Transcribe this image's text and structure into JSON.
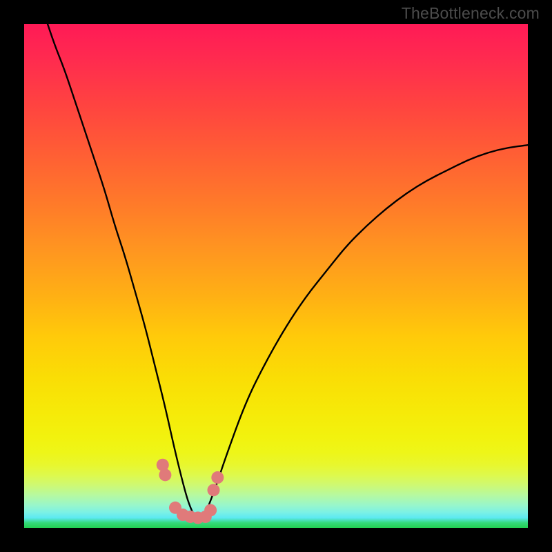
{
  "watermark": "TheBottleneck.com",
  "chart_data": {
    "type": "line",
    "title": "",
    "xlabel": "",
    "ylabel": "",
    "xlim": [
      0,
      100
    ],
    "ylim": [
      0,
      100
    ],
    "background_gradient": {
      "top": "#ff1a56",
      "mid": "#ffca0a",
      "bottom": "#23d053"
    },
    "series": [
      {
        "name": "curve",
        "style": "black-line",
        "x": [
          4,
          6,
          8,
          10,
          12,
          14,
          16,
          18,
          20,
          22,
          24,
          26,
          28,
          30,
          32,
          33,
          34,
          35,
          36,
          38,
          40,
          44,
          48,
          52,
          56,
          60,
          64,
          68,
          72,
          76,
          80,
          84,
          88,
          92,
          96,
          100
        ],
        "values": [
          102,
          96,
          91,
          85,
          79,
          73,
          67,
          60,
          54,
          47,
          40,
          32,
          24,
          15,
          7,
          4,
          2,
          1.5,
          2.8,
          8,
          14,
          25,
          33,
          40,
          46,
          51,
          56,
          60,
          63.5,
          66.5,
          69,
          71,
          73,
          74.5,
          75.5,
          76
        ]
      },
      {
        "name": "highlight-dots",
        "style": "pink-round",
        "x": [
          27.5,
          28.0,
          30.0,
          31.5,
          33.0,
          34.5,
          36.0,
          37.0,
          37.6,
          38.4
        ],
        "values": [
          12.5,
          10.5,
          4.0,
          2.6,
          2.2,
          2.0,
          2.2,
          3.5,
          7.5,
          10.0
        ]
      }
    ],
    "colors": {
      "curve": "#000000",
      "dots": "#e07a7a"
    }
  }
}
